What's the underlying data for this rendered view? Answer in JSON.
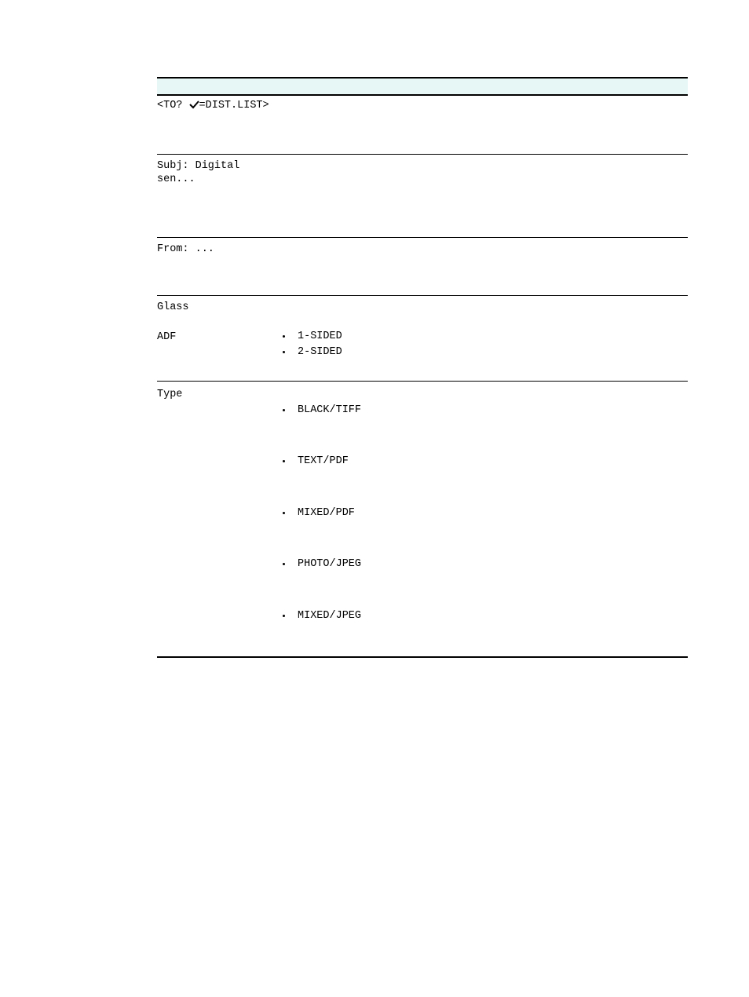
{
  "to": {
    "prefix": "<TO? ",
    "suffix": "=DIST.LIST>"
  },
  "subj": {
    "line1": "Subj: Digital",
    "line2": "sen..."
  },
  "from": "From: ...",
  "source": {
    "glass": "Glass",
    "adf": "ADF",
    "sides": [
      "1-SIDED",
      "2-SIDED"
    ]
  },
  "type": {
    "label": "Type",
    "options": [
      "BLACK/TIFF",
      "TEXT/PDF",
      "MIXED/PDF",
      "PHOTO/JPEG",
      "MIXED/JPEG"
    ]
  }
}
